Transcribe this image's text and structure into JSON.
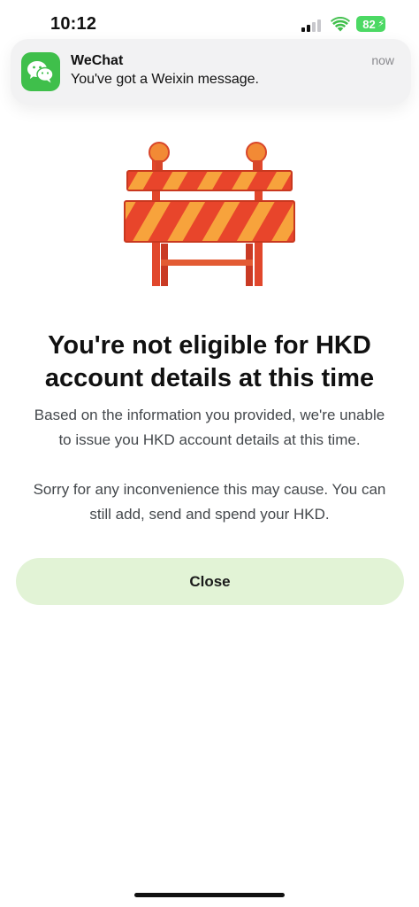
{
  "status_bar": {
    "time": "10:12",
    "battery": "82"
  },
  "notification": {
    "app": "WeChat",
    "message": "You've got a Weixin message.",
    "time": "now",
    "icon": "wechat-icon"
  },
  "illustration": {
    "icon": "road-barrier-icon"
  },
  "content": {
    "title_line1": "You're not eligible for HKD",
    "title_line2": "account details at this time",
    "paragraph1_line1": "Based on the information you provided, we're unable",
    "paragraph1_line2": "to issue you HKD account details at this time.",
    "paragraph2_line1": "Sorry for any inconvenience this may cause. You can",
    "paragraph2_line2": "still add, send and spend your HKD."
  },
  "actions": {
    "close_label": "Close"
  },
  "colors": {
    "button_bg": "#e2f3d6",
    "battery": "#4cd964",
    "wechat_green": "#3fbf4b",
    "barrier_orange": "#f07a2e"
  }
}
